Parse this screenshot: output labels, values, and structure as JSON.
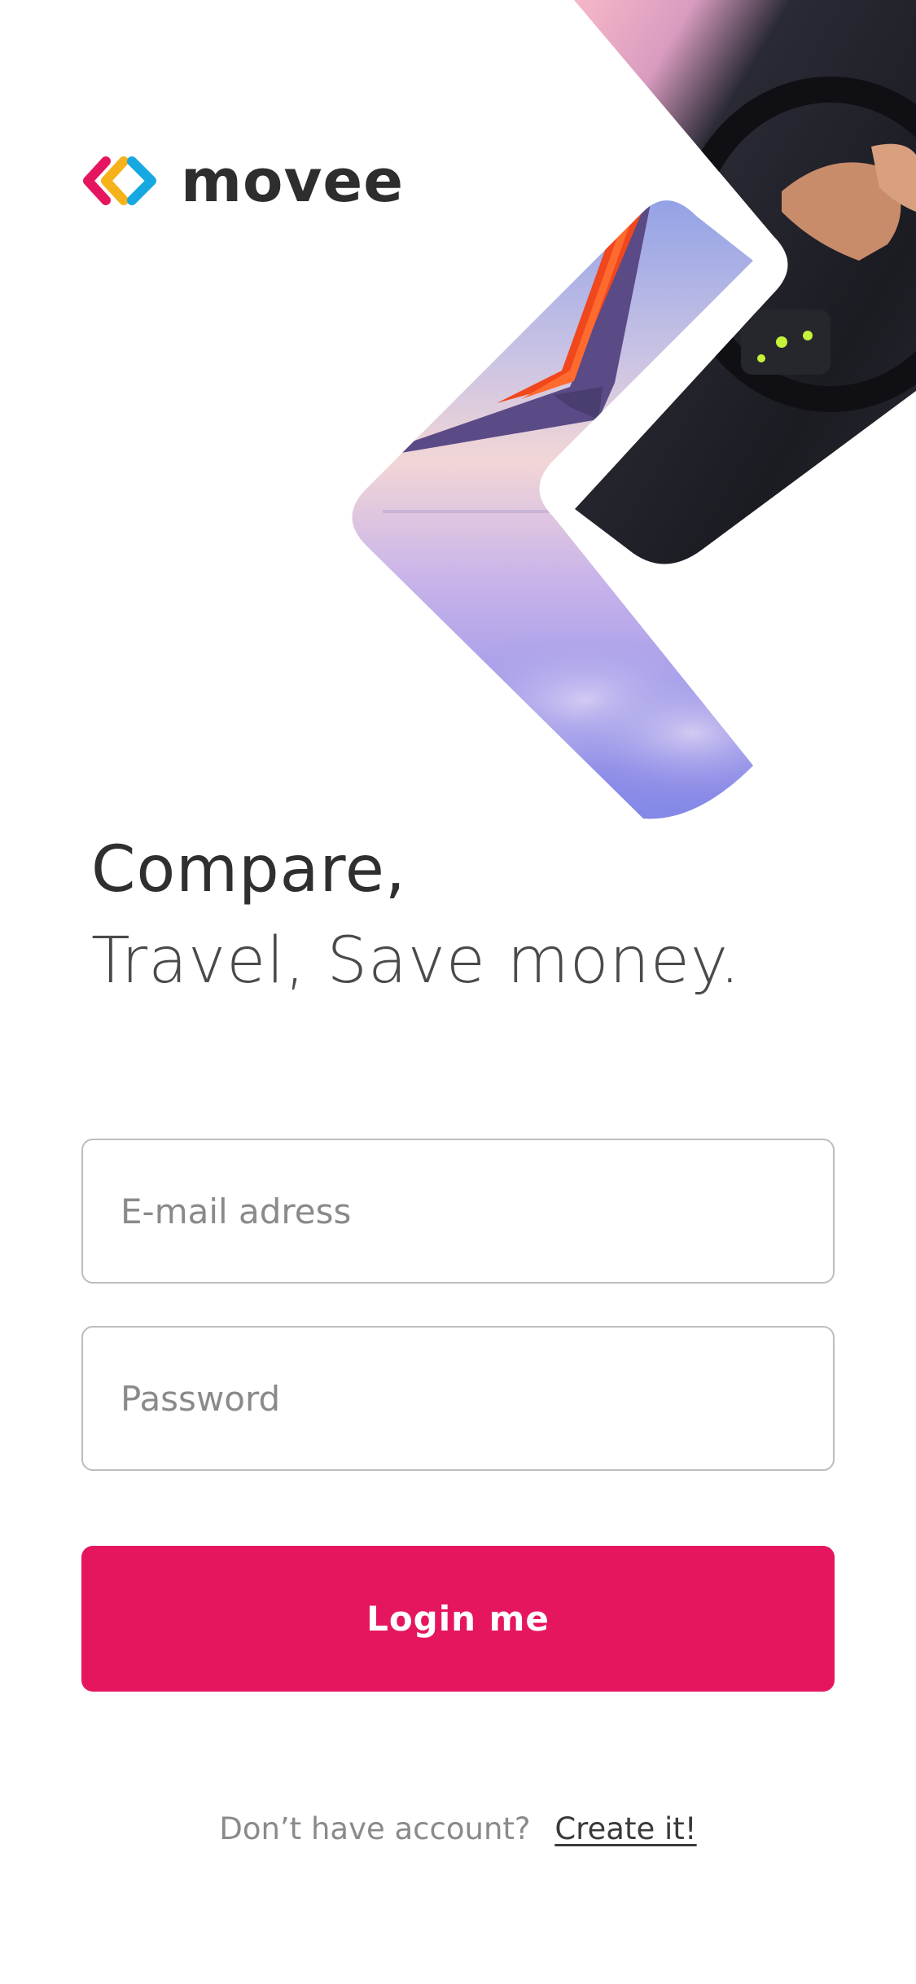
{
  "brand": {
    "name": "movee",
    "logo_icon": "chevrons-logo-icon",
    "logo_colors": [
      "#e5165f",
      "#f6b21a",
      "#16a8e0"
    ]
  },
  "hero": {
    "images": [
      "airplane-wing-over-clouds",
      "hands-on-steering-wheel"
    ]
  },
  "headline": {
    "line1": "Compare,",
    "line2": "Travel, Save money."
  },
  "form": {
    "email_placeholder": "E-mail adress",
    "password_placeholder": "Password",
    "email_value": "",
    "password_value": ""
  },
  "login_button": {
    "label": "Login me",
    "color": "#e5165f"
  },
  "signup": {
    "prompt": "Don’t have account?",
    "link_label": "Create it!"
  }
}
